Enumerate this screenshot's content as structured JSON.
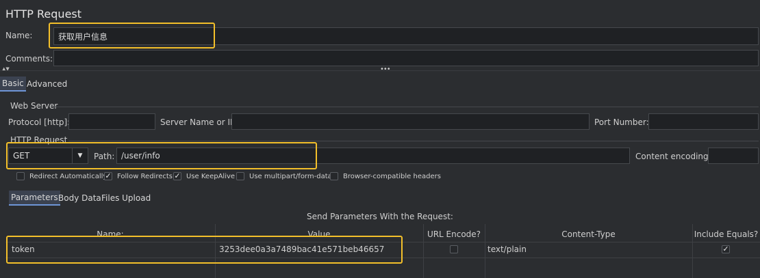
{
  "title": "HTTP Request",
  "name": {
    "label": "Name:",
    "value": "获取用户信息"
  },
  "comments": {
    "label": "Comments:",
    "value": ""
  },
  "tabs": [
    {
      "label": "Basic",
      "active": true
    },
    {
      "label": "Advanced",
      "active": false
    }
  ],
  "web_server": {
    "section_title": "Web Server",
    "protocol_label": "Protocol [http]:",
    "protocol_value": "",
    "server_label": "Server Name or IP:",
    "server_value": "",
    "port_label": "Port Number:",
    "port_value": ""
  },
  "http_request": {
    "section_title": "HTTP Request",
    "method": "GET",
    "path_label": "Path:",
    "path_value": "/user/info",
    "encoding_label": "Content encoding:",
    "encoding_value": ""
  },
  "options": [
    {
      "label": "Redirect Automatically",
      "checked": false
    },
    {
      "label": "Follow Redirects",
      "checked": true
    },
    {
      "label": "Use KeepAlive",
      "checked": true
    },
    {
      "label": "Use multipart/form-data",
      "checked": false
    },
    {
      "label": "Browser-compatible headers",
      "checked": false
    }
  ],
  "subtabs": [
    {
      "label": "Parameters",
      "active": true
    },
    {
      "label": "Body Data",
      "active": false
    },
    {
      "label": "Files Upload",
      "active": false
    }
  ],
  "params": {
    "caption": "Send Parameters With the Request:",
    "columns": [
      "Name:",
      "Value",
      "URL Encode?",
      "Content-Type",
      "Include Equals?"
    ],
    "rows": [
      {
        "name": "token",
        "value": "3253dee0a3a7489bac41e571beb46657",
        "url_encode": false,
        "content_type": "text/plain",
        "include_equals": true
      }
    ]
  },
  "colors": {
    "highlight": "#f4c02a",
    "tab_accent": "#6f96d8",
    "background": "#2b2d30"
  }
}
